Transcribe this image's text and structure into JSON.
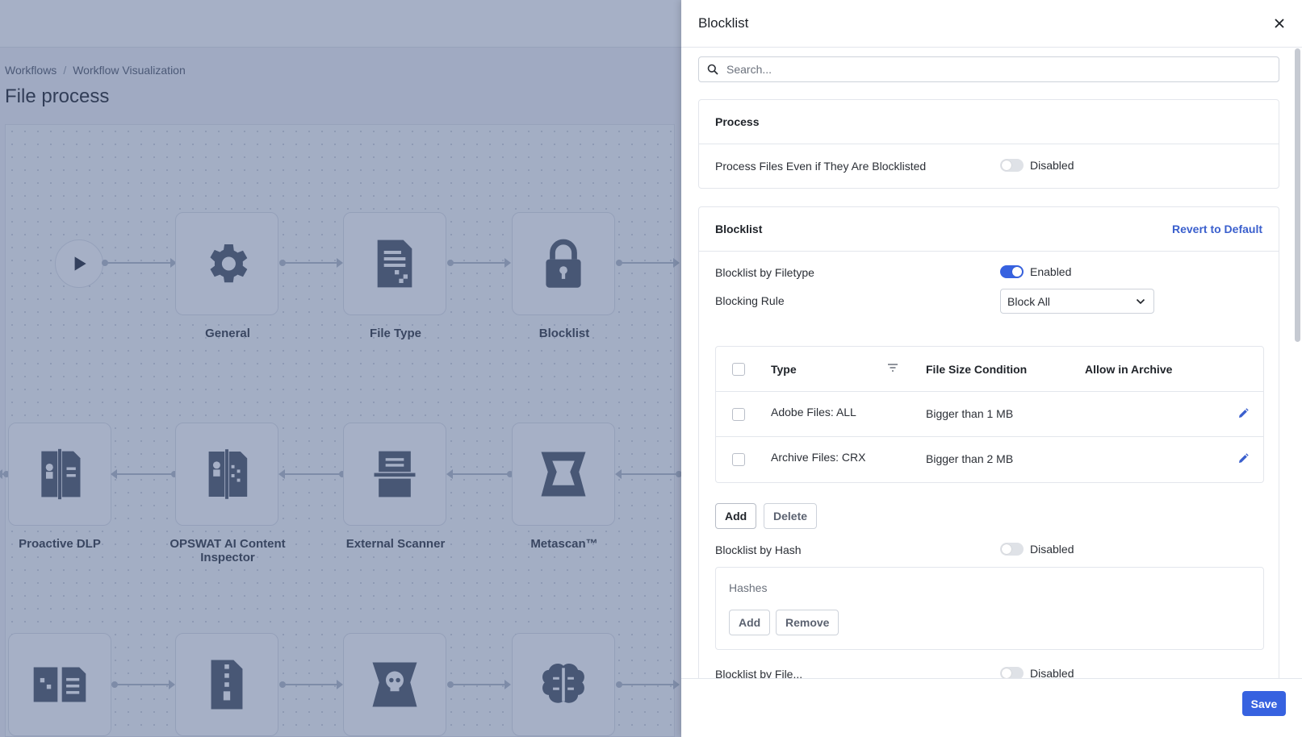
{
  "breadcrumb": {
    "items": [
      "Workflows",
      "Workflow Visualization"
    ],
    "separator": "/"
  },
  "page_title": "File process",
  "workflow": {
    "row1": [
      "General",
      "File Type",
      "Blocklist"
    ],
    "row2": [
      "Proactive DLP",
      "OPSWAT AI Content Inspector",
      "External Scanner",
      "Metascan™"
    ],
    "icons_row1": [
      "play-icon",
      "gear-icon",
      "file-type-icon",
      "lock-icon"
    ],
    "icons_row2": [
      "proactive-dlp-icon",
      "ai-content-inspector-icon",
      "external-scanner-icon",
      "metascan-icon"
    ],
    "icons_row3": [
      "document-icon",
      "archive-icon",
      "skull-icon",
      "brain-icon"
    ]
  },
  "drawer": {
    "title": "Blocklist",
    "search_placeholder": "Search...",
    "process_section": {
      "title": "Process",
      "setting_label": "Process Files Even if They Are Blocklisted",
      "setting_state": "Disabled"
    },
    "blocklist_section": {
      "title": "Blocklist",
      "revert_label": "Revert to Default",
      "by_filetype_label": "Blocklist by Filetype",
      "by_filetype_state": "Enabled",
      "blocking_rule_label": "Blocking Rule",
      "blocking_rule_value": "Block All",
      "table": {
        "columns": [
          "Type",
          "File Size Condition",
          "Allow in Archive"
        ],
        "rows": [
          {
            "type": "Adobe Files: ALL",
            "size": "Bigger than 1 MB",
            "archive": ""
          },
          {
            "type": "Archive Files: CRX",
            "size": "Bigger than 2 MB",
            "archive": ""
          }
        ]
      },
      "add_label": "Add",
      "delete_label": "Delete",
      "by_hash_label": "Blocklist by Hash",
      "by_hash_state": "Disabled",
      "hashes_title": "Hashes",
      "hash_add_label": "Add",
      "hash_remove_label": "Remove",
      "by_filename_label": "Blocklist by File...",
      "by_filename_state": "Disabled"
    },
    "save_label": "Save"
  },
  "colors": {
    "accent": "#3762e0",
    "overlay": "#3a5080",
    "link": "#3a5fcd"
  }
}
